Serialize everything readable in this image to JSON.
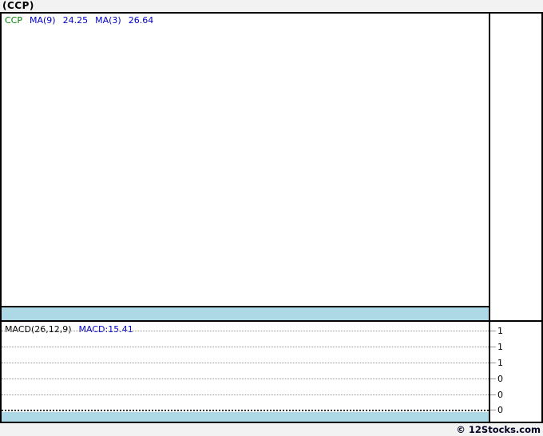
{
  "page": {
    "title": "(CCP)",
    "copyright": "© 12Stocks.com"
  },
  "colors": {
    "page_background": "#f2f2f2",
    "panel_background": "#ffffff",
    "frame_border": "#000000",
    "collapsed_band": "#add8e6",
    "gridline": "#999999",
    "zero_gridline": "#333333",
    "symbol_green": "#008000",
    "indicator_blue": "#0000cc",
    "text_black": "#000000"
  },
  "price_panel": {
    "symbol_label": "CCP",
    "ma9_label": "MA(9)",
    "ma9_value": "24.25",
    "ma3_label": "MA(3)",
    "ma3_value": "26.64"
  },
  "macd_panel": {
    "indicator_label": "MACD(26,12,9)",
    "value_label": "MACD:15.41",
    "y_ticks": [
      "1",
      "1",
      "1",
      "0",
      "0",
      "0"
    ]
  },
  "chart_data": [
    {
      "type": "line",
      "panel": "price",
      "title": "(CCP)",
      "legend": [
        "CCP",
        "MA(9) 24.25",
        "MA(3) 26.64"
      ],
      "legend_position": "top-left",
      "series": [
        {
          "name": "CCP",
          "color": "#008000",
          "values": []
        },
        {
          "name": "MA(9)",
          "color": "#0000cc",
          "last_value": 24.25,
          "values": []
        },
        {
          "name": "MA(3)",
          "color": "#0000cc",
          "last_value": 26.64,
          "values": []
        }
      ],
      "grid": "off",
      "note": "plot area is rendered empty (no price data drawn)"
    },
    {
      "type": "line",
      "panel": "macd",
      "legend": [
        "MACD(26,12,9)",
        "MACD:15.41"
      ],
      "legend_position": "top-left",
      "last_value": 15.41,
      "y_tick_labels": [
        "1",
        "1",
        "1",
        "0",
        "0",
        "0"
      ],
      "grid": "dotted horizontal lines, bottom zero line emphasized",
      "series": [],
      "note": "plot area is rendered empty except gridlines"
    }
  ]
}
